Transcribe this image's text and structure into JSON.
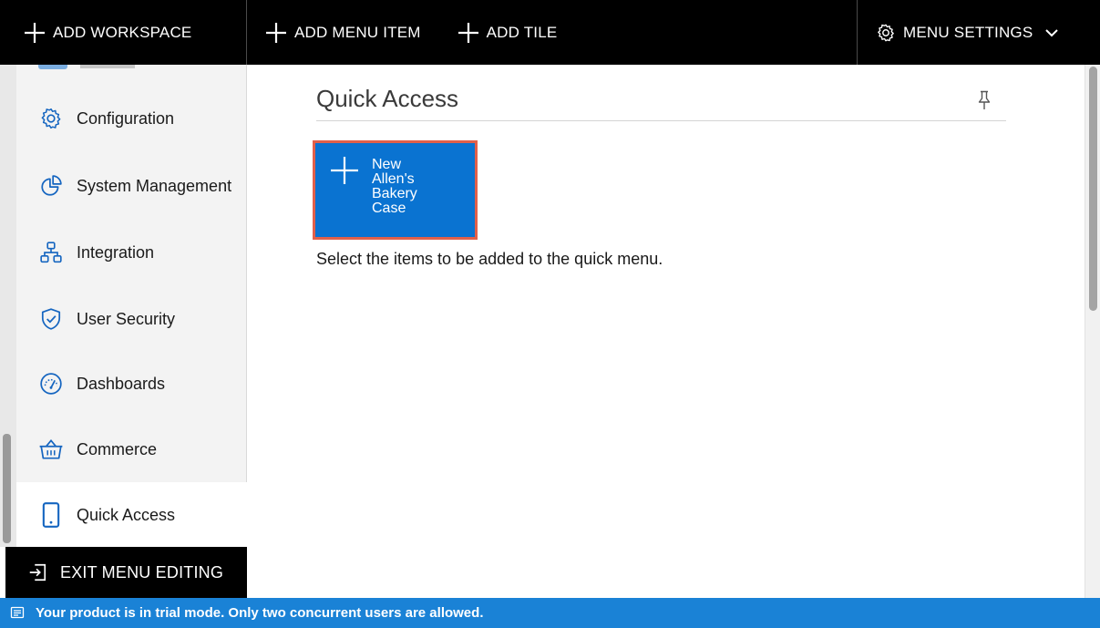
{
  "toolbar": {
    "add_workspace": "ADD WORKSPACE",
    "add_menu_item": "ADD MENU ITEM",
    "add_tile": "ADD TILE",
    "menu_settings": "MENU SETTINGS"
  },
  "sidebar": {
    "items": [
      {
        "label": "Configuration",
        "icon": "gear-icon"
      },
      {
        "label": "System Management",
        "icon": "pie-chart-icon"
      },
      {
        "label": "Integration",
        "icon": "network-icon"
      },
      {
        "label": "User Security",
        "icon": "shield-check-icon"
      },
      {
        "label": "Dashboards",
        "icon": "gauge-icon"
      },
      {
        "label": "Commerce",
        "icon": "basket-icon"
      },
      {
        "label": "Quick Access",
        "icon": "mobile-icon",
        "active": true
      }
    ],
    "exit_label": "EXIT MENU EDITING"
  },
  "main": {
    "title": "Quick Access",
    "tile": {
      "line1": "New",
      "line2": "Allen's",
      "line3": "Bakery",
      "line4": "Case"
    },
    "hint": "Select the items to be added to the quick menu."
  },
  "notice": {
    "text": "Your product is in trial mode. Only two concurrent users are allowed."
  },
  "colors": {
    "toolbar_bg": "#000000",
    "tile_bg": "#0a73d1",
    "tile_border": "#e2604a",
    "notice_bg": "#1a82d6",
    "icon_blue": "#1565c0"
  }
}
